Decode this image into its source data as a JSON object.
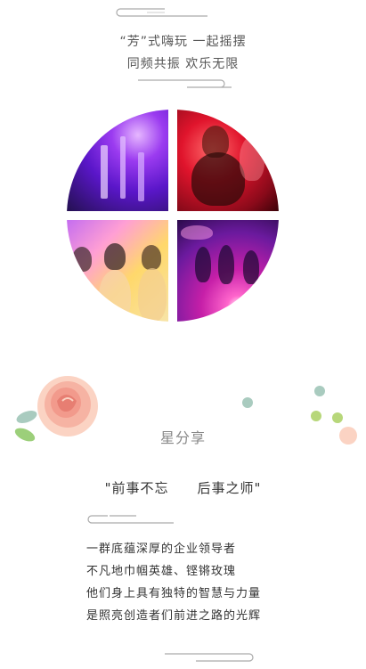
{
  "header": {
    "line1": "“芳”式嗨玩  一起摇摆",
    "line2": "同频共振   欢乐无限"
  },
  "photos": {
    "icons": [
      "cocktail-glasses-photo",
      "masked-dancer-photo",
      "masked-women-photo",
      "stage-laser-photo"
    ]
  },
  "share": {
    "title": "星分享",
    "quote_left": "\"前事不忘",
    "quote_right": "后事之师\"",
    "lines": [
      "一群底蕴深厚的企业领导者",
      "不凡地巾帼英雄、铿锵玫瑰",
      "他们身上具有独特的智慧与力量",
      "是照亮创造者们前进之路的光辉"
    ]
  },
  "colors": {
    "swirl": "#aaaaaa",
    "rose": "#f29a8c",
    "leaf": "#9ccf7a",
    "dot_teal": "#a9cbbf",
    "dot_green": "#b7d77a",
    "dot_peach": "#fbd3c3"
  }
}
